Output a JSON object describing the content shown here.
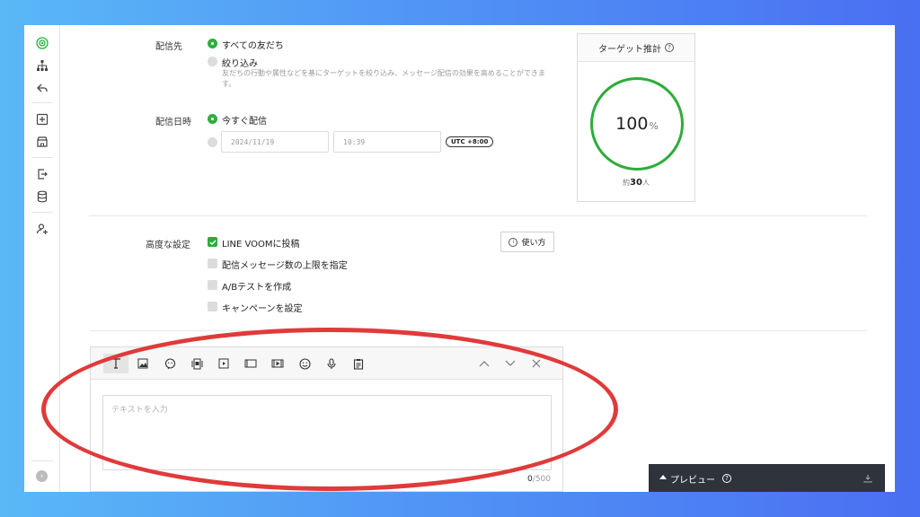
{
  "settings": {
    "delivery_target_label": "配信先",
    "target_all": "すべての友だち",
    "target_filter": "絞り込み",
    "target_filter_hint_1": "友だちの行動や属性などを基にターゲットを絞り込み、メッセージ配信の効果を高めることができま",
    "target_filter_hint_2": "す。",
    "schedule_label": "配信日時",
    "schedule_now": "今すぐ配信",
    "date_value": "2024/11/19",
    "time_value": "10:39",
    "timezone": "UTC +8:00",
    "advanced_label": "高度な設定",
    "post_voom": "LINE VOOMに投稿",
    "limit_messages": "配信メッセージ数の上限を指定",
    "ab_test": "A/Bテストを作成",
    "campaign": "キャンペーンを設定",
    "howto_button": "使い方"
  },
  "target_estimate": {
    "title": "ターゲット推計",
    "percent": "100",
    "percent_sign": "%",
    "approx_prefix": "約",
    "count": "30",
    "count_suffix": "人",
    "coverage": 1.0
  },
  "editor": {
    "placeholder": "テキストを入力",
    "count_current": "0",
    "count_max": "/500",
    "tools": [
      "text-icon",
      "image-icon",
      "stamp-icon",
      "card-message-icon",
      "video-icon",
      "rich-message-icon",
      "rich-video-icon",
      "emoji-icon",
      "voice-icon",
      "survey-icon"
    ]
  },
  "preview": {
    "label": "プレビュー"
  },
  "colors": {
    "accent_green": "#2cad3a",
    "highlight_red": "#e03a3a",
    "preview_bar": "#2f333b"
  }
}
